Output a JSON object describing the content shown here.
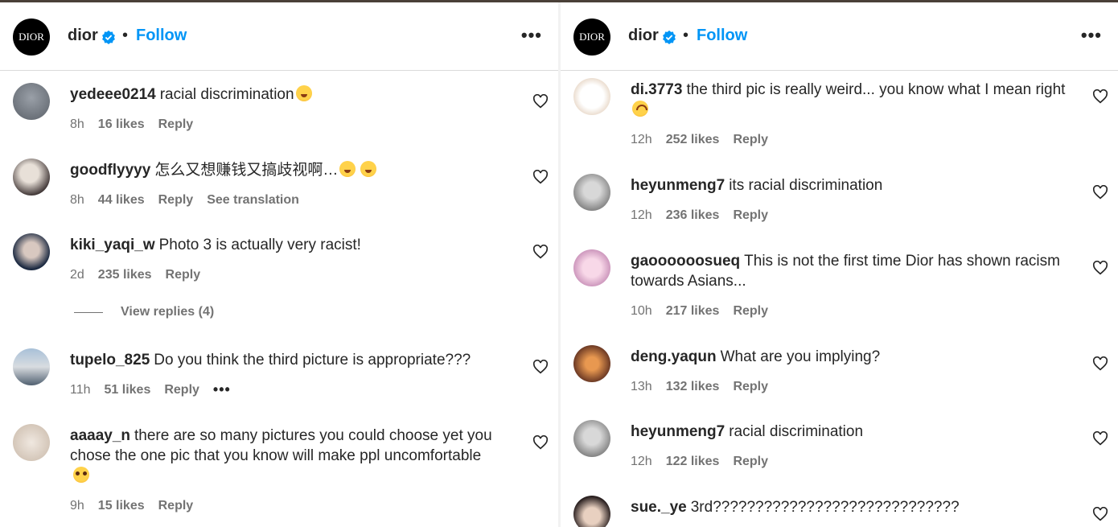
{
  "header": {
    "logo_text": "DIOR",
    "account_name": "dior",
    "separator": "•",
    "follow_label": "Follow",
    "more_label": "•••"
  },
  "left_comments": [
    {
      "user": "yedeee0214",
      "text": "racial discrimination",
      "emoji": "sweat",
      "time": "8h",
      "likes": "16 likes",
      "reply": "Reply"
    },
    {
      "user": "goodflyyyy",
      "text": "怎么又想赚钱又搞歧视啊…",
      "emoji": "sweat2",
      "time": "8h",
      "likes": "44 likes",
      "reply": "Reply",
      "translate": "See translation"
    },
    {
      "user": "kiki_yaqi_w",
      "text": "Photo 3 is actually very racist!",
      "time": "2d",
      "likes": "235 likes",
      "reply": "Reply",
      "view_replies": "View replies (4)"
    },
    {
      "user": "tupelo_825",
      "text": "Do you think the third picture is appropriate???",
      "time": "11h",
      "likes": "51 likes",
      "reply": "Reply",
      "more": "•••"
    },
    {
      "user": "aaaay_n",
      "text": "there are so many pictures you could choose yet you chose the one pic that you know will make ppl uncomfortable",
      "emoji": "plead",
      "time": "9h",
      "likes": "15 likes",
      "reply": "Reply"
    }
  ],
  "right_comments": [
    {
      "user": "di.3773",
      "text": "the third pic is really weird... you know what I mean right",
      "emoji": "upside",
      "time": "12h",
      "likes": "252 likes",
      "reply": "Reply"
    },
    {
      "user": "heyunmeng7",
      "text": "its racial discrimination",
      "time": "12h",
      "likes": "236 likes",
      "reply": "Reply"
    },
    {
      "user": "gaoooooosueq",
      "text": "This is not the first time Dior has shown racism towards Asians...",
      "time": "10h",
      "likes": "217 likes",
      "reply": "Reply"
    },
    {
      "user": "deng.yaqun",
      "text": "What are you implying?",
      "time": "13h",
      "likes": "132 likes",
      "reply": "Reply"
    },
    {
      "user": "heyunmeng7",
      "text": "racial discrimination",
      "time": "12h",
      "likes": "122 likes",
      "reply": "Reply"
    },
    {
      "user": "sue._ye",
      "text": "3rd?????????????????????????????"
    }
  ],
  "colors": {
    "accent": "#0095f6",
    "text": "#262626",
    "muted": "#737373"
  }
}
